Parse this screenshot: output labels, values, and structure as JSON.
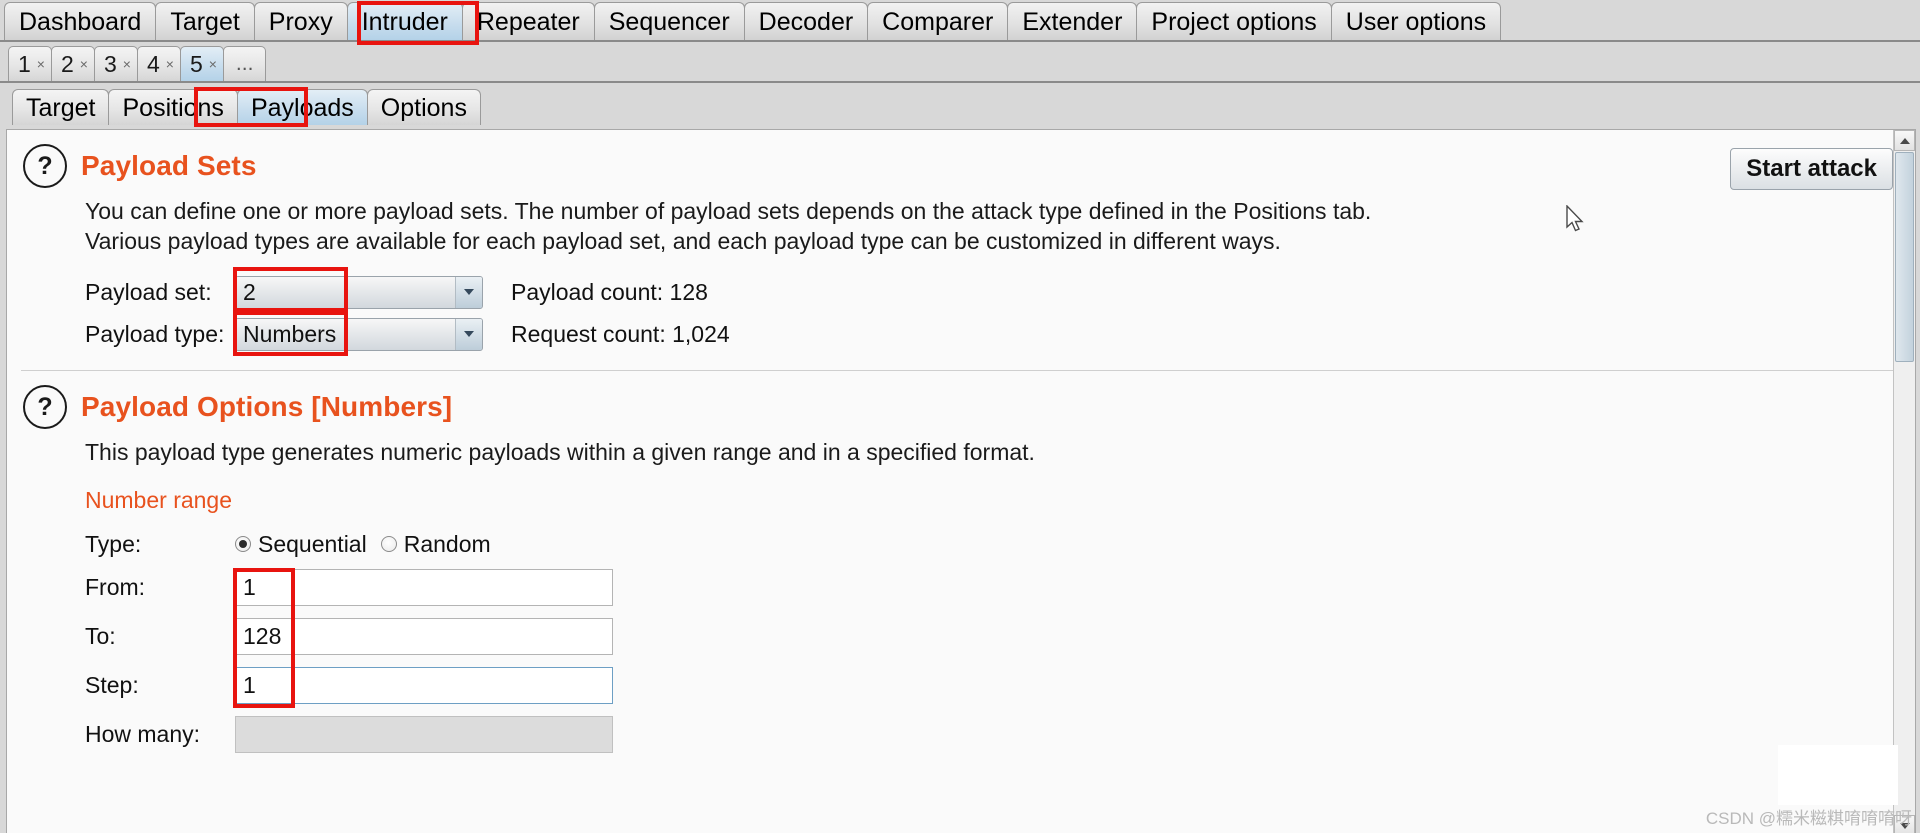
{
  "app": {
    "name": "Burp Suite Intruder"
  },
  "main_tabs": [
    {
      "label": "Dashboard",
      "selected": false
    },
    {
      "label": "Target",
      "selected": false
    },
    {
      "label": "Proxy",
      "selected": false
    },
    {
      "label": "Intruder",
      "selected": true
    },
    {
      "label": "Repeater",
      "selected": false
    },
    {
      "label": "Sequencer",
      "selected": false
    },
    {
      "label": "Decoder",
      "selected": false
    },
    {
      "label": "Comparer",
      "selected": false
    },
    {
      "label": "Extender",
      "selected": false
    },
    {
      "label": "Project options",
      "selected": false
    },
    {
      "label": "User options",
      "selected": false
    }
  ],
  "attack_tabs": [
    {
      "label": "1",
      "selected": false,
      "close": "×"
    },
    {
      "label": "2",
      "selected": false,
      "close": "×"
    },
    {
      "label": "3",
      "selected": false,
      "close": "×"
    },
    {
      "label": "4",
      "selected": false,
      "close": "×"
    },
    {
      "label": "5",
      "selected": true,
      "close": "×"
    },
    {
      "label": "...",
      "selected": false,
      "close": ""
    }
  ],
  "sub_tabs": [
    {
      "label": "Target",
      "selected": false
    },
    {
      "label": "Positions",
      "selected": false
    },
    {
      "label": "Payloads",
      "selected": true
    },
    {
      "label": "Options",
      "selected": false
    }
  ],
  "toolbar": {
    "start_attack_label": "Start attack"
  },
  "payload_sets": {
    "help_glyph": "?",
    "title": "Payload Sets",
    "desc_line1": "You can define one or more payload sets. The number of payload sets depends on the attack type defined in the Positions tab.",
    "desc_line2": "Various payload types are available for each payload set, and each payload type can be customized in different ways.",
    "payload_set_label": "Payload set:",
    "payload_set_value": "2",
    "payload_type_label": "Payload type:",
    "payload_type_value": "Numbers",
    "payload_count_text": "Payload count: 128",
    "request_count_text": "Request count: 1,024"
  },
  "payload_options": {
    "help_glyph": "?",
    "title": "Payload Options [Numbers]",
    "desc": "This payload type generates numeric payloads within a given range and in a specified format.",
    "number_range_label": "Number range",
    "type_label": "Type:",
    "type_sequential": "Sequential",
    "type_random": "Random",
    "type_selected": "Sequential",
    "from_label": "From:",
    "from_value": "1",
    "to_label": "To:",
    "to_value": "128",
    "step_label": "Step:",
    "step_value": "1",
    "how_many_label": "How many:",
    "how_many_value": ""
  },
  "colors": {
    "accent_orange": "#e8521e",
    "highlight_red": "#e8140f",
    "tab_selected_blue": "#b4d2e8"
  },
  "watermark": {
    "text": "CSDN @糯米糍粸唷唷唷呀"
  }
}
